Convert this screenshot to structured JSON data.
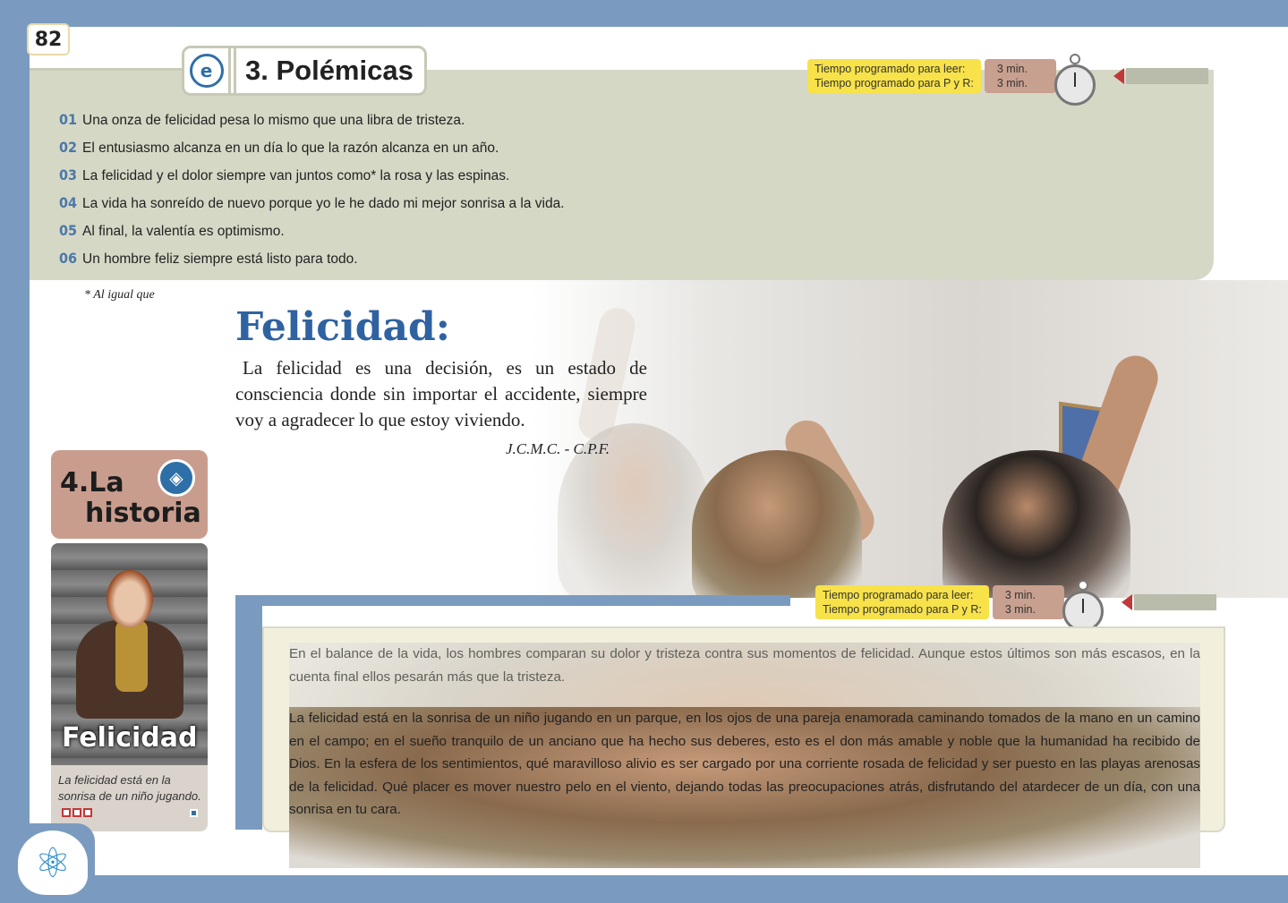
{
  "page_number": "82",
  "section": {
    "title": "3. Polémicas",
    "icon": "polemicas-badge-icon",
    "icon_glyph": "e",
    "quotes": [
      {
        "num": "01",
        "text": "Una onza de felicidad pesa lo mismo que una libra de tristeza."
      },
      {
        "num": "02",
        "text": "El entusiasmo alcanza en un día lo que la razón alcanza en un año."
      },
      {
        "num": "03",
        "text": "La felicidad y el dolor siempre van juntos como* la rosa y las espinas."
      },
      {
        "num": "04",
        "text": "La vida ha sonreído de nuevo porque yo le he dado mi mejor sonrisa a la vida."
      },
      {
        "num": "05",
        "text": "Al final, la valentía es optimismo."
      },
      {
        "num": "06",
        "text": "Un hombre feliz siempre está listo para todo."
      }
    ],
    "footnote": "* Al igual que"
  },
  "timer_top": {
    "label_read": "Tiempo programado para leer:",
    "label_pr": "Tiempo programado para P y R:",
    "value_read": "3 min.",
    "value_pr": "3 min."
  },
  "timer_bottom": {
    "label_read": "Tiempo programado para leer:",
    "label_pr": "Tiempo programado para P y R:",
    "value_read": "3 min.",
    "value_pr": "3 min."
  },
  "feature": {
    "headline": "Felicidad:",
    "body": "La felicidad es una decisión, es un estado de consciencia donde sin importar el accidente, siempre voy a agradecer lo que estoy viviendo.",
    "signature": "J.C.M.C. - C.P.F."
  },
  "historia": {
    "line1": "4.La",
    "line2": "historia",
    "icon_glyph": "◈"
  },
  "story_card": {
    "title": "Felicidad",
    "caption": "La felicidad está en la sonrisa de un niño jugando."
  },
  "story_text": {
    "paragraph1": "En el balance de la vida, los hombres comparan su dolor y tristeza contra sus momentos de felicidad. Aunque estos últimos son más escasos, en la cuenta final ellos pesarán más que la tristeza.",
    "paragraph2": "La felicidad está en la sonrisa de un niño jugando en un parque, en los ojos de una pareja enamorada caminando tomados de la mano en un camino en el campo; en el sueño tranquilo de un anciano que ha hecho sus deberes, esto es el don más amable y noble que la humanidad ha recibido de Dios. En la esfera de los sentimientos, qué maravilloso alivio es ser cargado por una corriente rosada de felicidad y ser puesto en las playas arenosas de la felicidad. Qué placer es mover nuestro pelo en el viento, dejando todas las preocupaciones atrás, disfrutando del atardecer de un día, con una sonrisa en tu cara."
  },
  "logo": {
    "icon": "atom-head-logo-icon",
    "glyph": "⚛"
  }
}
